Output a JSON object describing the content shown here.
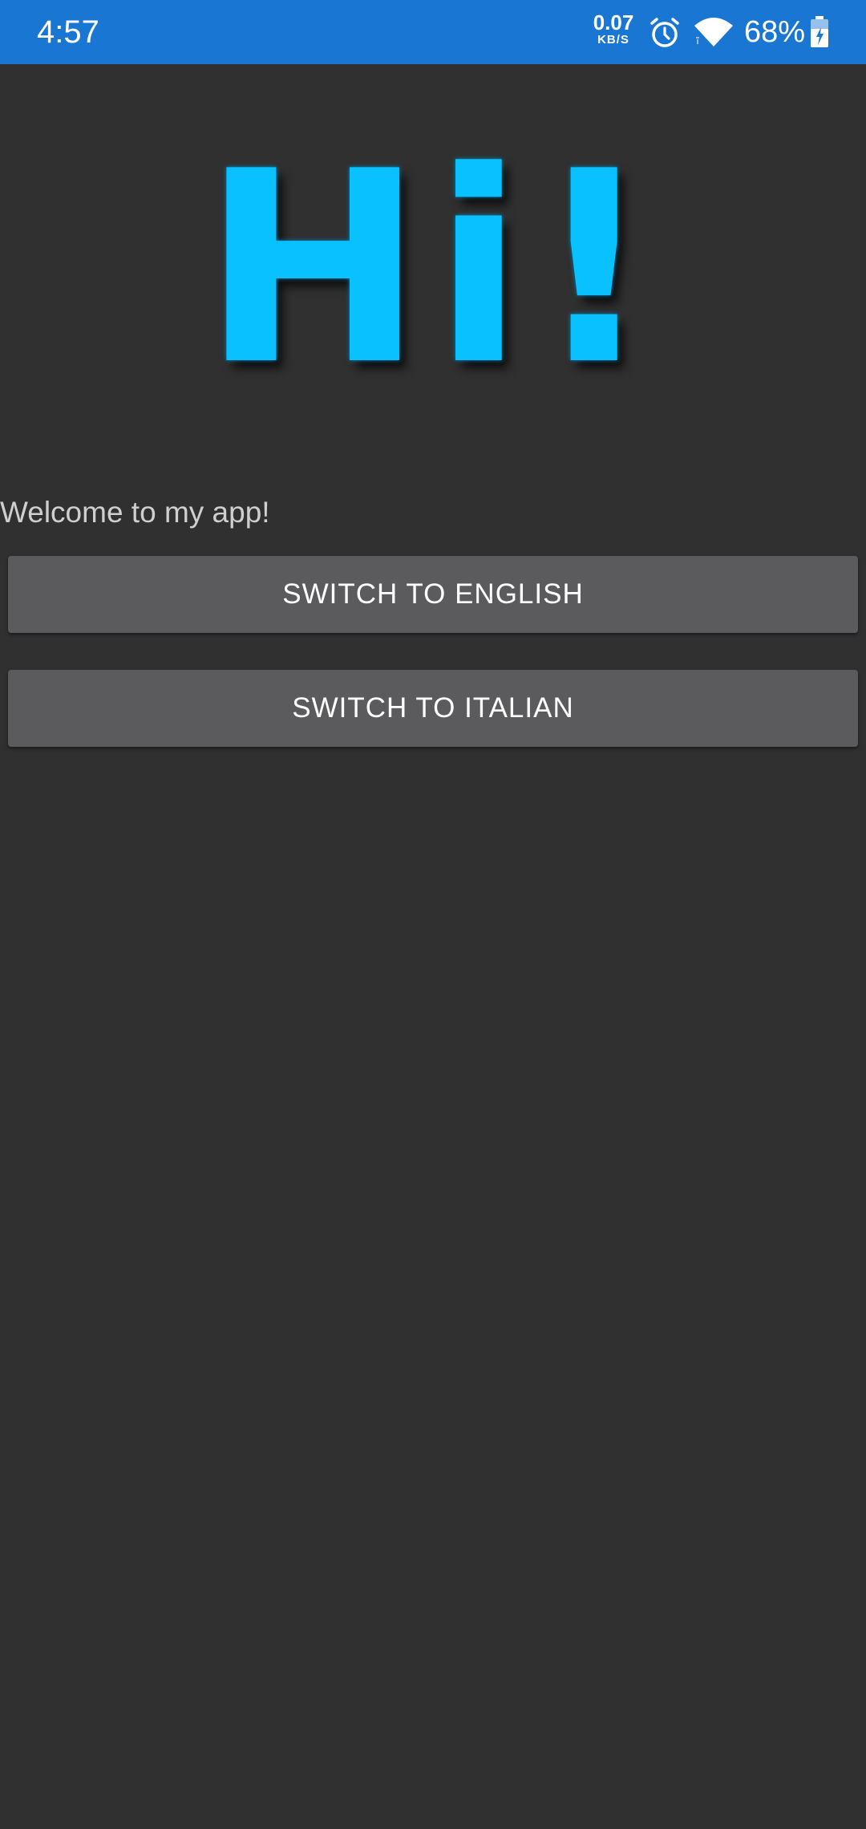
{
  "status_bar": {
    "time": "4:57",
    "net_speed_value": "0.07",
    "net_speed_unit": "KB/S",
    "battery_percent": "68%",
    "background_color": "#1976d2",
    "icons": [
      "alarm-icon",
      "wifi-icon",
      "battery-charging-icon"
    ]
  },
  "hero": {
    "text": "Hi!",
    "color": "#09c1ff"
  },
  "main": {
    "welcome_text": "Welcome to my app!",
    "buttons": {
      "english_label": "SWITCH TO ENGLISH",
      "italian_label": "SWITCH TO ITALIAN"
    },
    "background_color": "#303030"
  }
}
